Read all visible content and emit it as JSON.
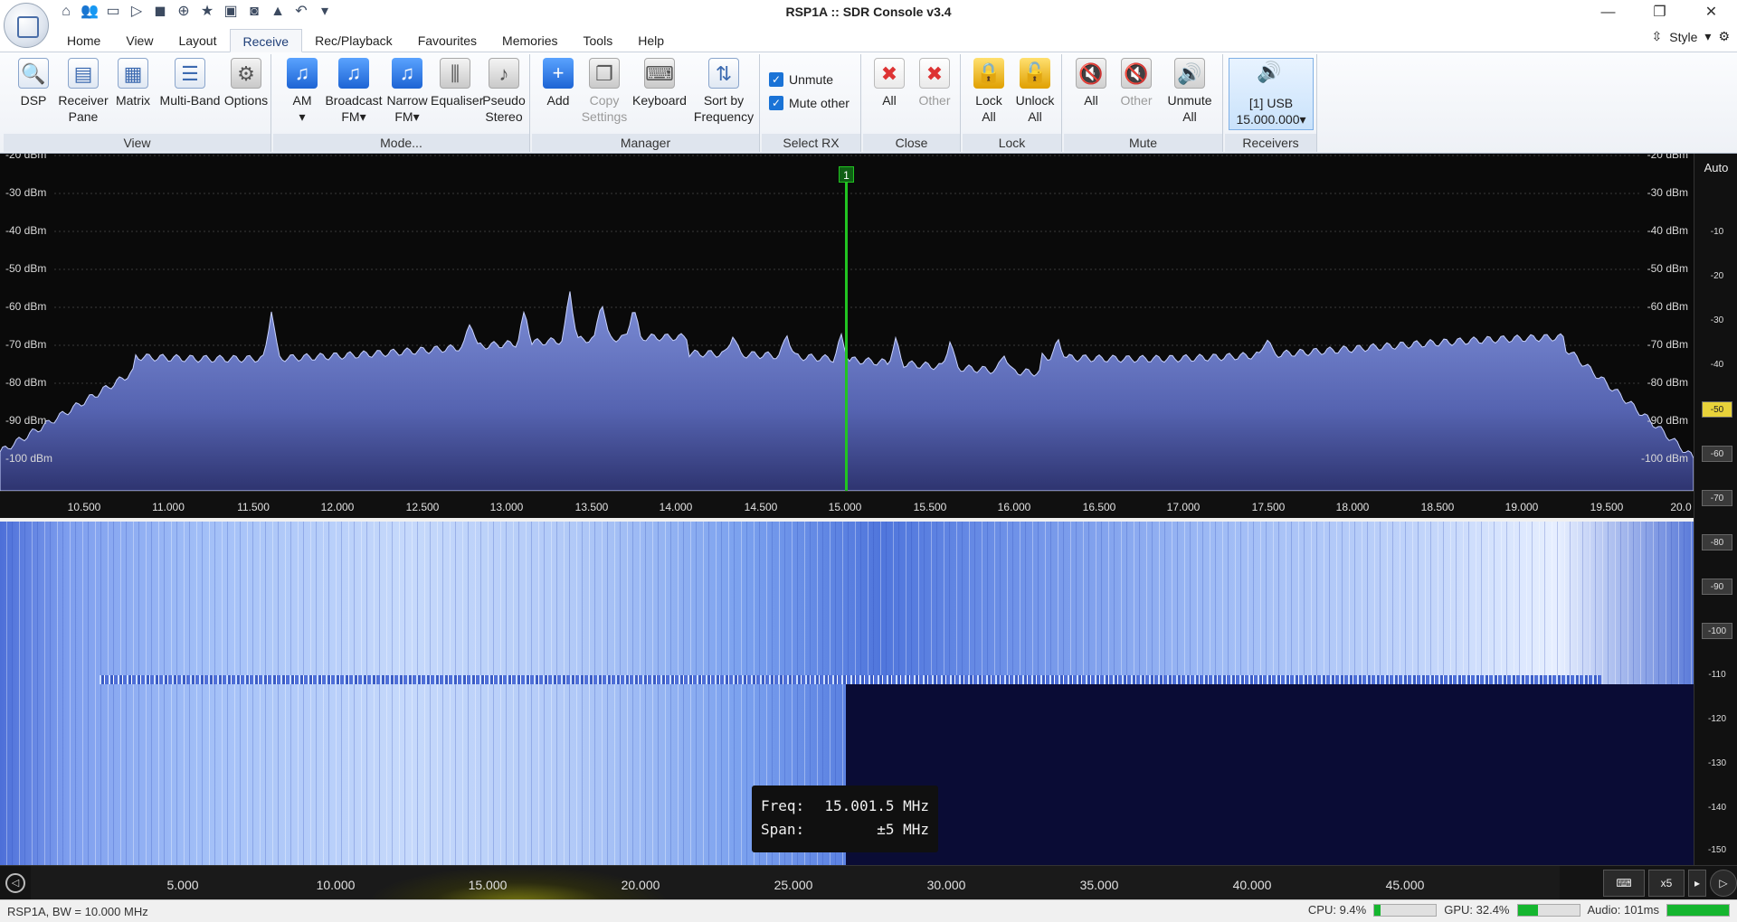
{
  "window": {
    "title": "RSP1A :: SDR Console v3.4",
    "controls": [
      "—",
      "❐",
      "✕"
    ]
  },
  "quick_access": [
    "home-icon",
    "users-icon",
    "folder-icon",
    "play-icon",
    "stop-icon",
    "plus-circle-icon",
    "star-icon",
    "lock-icon",
    "camera-icon",
    "flask-icon",
    "undo-icon",
    "dropdown-icon"
  ],
  "tabs": [
    {
      "label": "Home"
    },
    {
      "label": "View"
    },
    {
      "label": "Layout"
    },
    {
      "label": "Receive",
      "active": true
    },
    {
      "label": "Rec/Playback"
    },
    {
      "label": "Favourites"
    },
    {
      "label": "Memories"
    },
    {
      "label": "Tools"
    },
    {
      "label": "Help"
    }
  ],
  "style_menu": {
    "label": "Style"
  },
  "ribbon": {
    "view": {
      "label": "View",
      "buttons": {
        "dsp": "DSP",
        "receiver_pane_1": "Receiver",
        "receiver_pane_2": "Pane",
        "matrix": "Matrix",
        "multiband": "Multi-Band",
        "options": "Options"
      }
    },
    "mode": {
      "label": "Mode...",
      "buttons": {
        "am": "AM",
        "bfm_1": "Broadcast",
        "bfm_2": "FM",
        "nfm_1": "Narrow",
        "nfm_2": "FM",
        "equaliser": "Equaliser",
        "pseudo_1": "Pseudo",
        "pseudo_2": "Stereo"
      }
    },
    "manager": {
      "label": "Manager",
      "buttons": {
        "add": "Add",
        "copy_1": "Copy",
        "copy_2": "Settings",
        "keyboard": "Keyboard",
        "sort_1": "Sort by",
        "sort_2": "Frequency"
      }
    },
    "select_rx": {
      "label": "Select RX",
      "unmute": "Unmute",
      "mute_other": "Mute other"
    },
    "close": {
      "label": "Close",
      "buttons": {
        "all": "All",
        "other": "Other"
      }
    },
    "lock": {
      "label": "Lock",
      "buttons": {
        "lock_1": "Lock",
        "lock_2": "All",
        "unlock_1": "Unlock",
        "unlock_2": "All"
      }
    },
    "mute": {
      "label": "Mute",
      "buttons": {
        "all": "All",
        "other": "Other",
        "unmute_1": "Unmute",
        "unmute_2": "All"
      }
    },
    "receivers": {
      "label": "Receivers",
      "line1": "[1]  USB",
      "line2": "15.000.000"
    }
  },
  "spectrum": {
    "db_labels": [
      "-20 dBm",
      "-30 dBm",
      "-40 dBm",
      "-50 dBm",
      "-60 dBm",
      "-70 dBm",
      "-80 dBm",
      "-90 dBm",
      "-100 dBm"
    ],
    "freq_ticks": [
      "10.500",
      "11.000",
      "11.500",
      "12.000",
      "12.500",
      "13.000",
      "13.500",
      "14.000",
      "14.500",
      "15.000",
      "15.500",
      "16.000",
      "16.500",
      "17.000",
      "17.500",
      "18.000",
      "18.500",
      "19.000",
      "19.500",
      "20.0"
    ],
    "marker_label": "1",
    "fill_color": "#5b6db8"
  },
  "right_scale": {
    "auto": "Auto",
    "marks": [
      "-10",
      "-20",
      "-30",
      "-40",
      "-50",
      "-60",
      "-70",
      "-80",
      "-90",
      "-100",
      "-110",
      "-120",
      "-130",
      "-140",
      "-150"
    ]
  },
  "tooltip": {
    "freq_label": "Freq:",
    "freq_value": "15.001.5 MHz",
    "span_label": "Span:",
    "span_value": "±5 MHz"
  },
  "overview": {
    "ticks": [
      "5.000",
      "10.000",
      "15.000",
      "20.000",
      "25.000",
      "30.000",
      "35.000",
      "40.000",
      "45.000"
    ],
    "zoom": "x5"
  },
  "status": {
    "left": "RSP1A, BW = 10.000 MHz",
    "cpu": "CPU: 9.4%",
    "gpu": "GPU: 32.4%",
    "audio": "Audio: 101ms",
    "cpu_level": 0.094,
    "gpu_level": 0.324,
    "audio_level": 1.0
  }
}
